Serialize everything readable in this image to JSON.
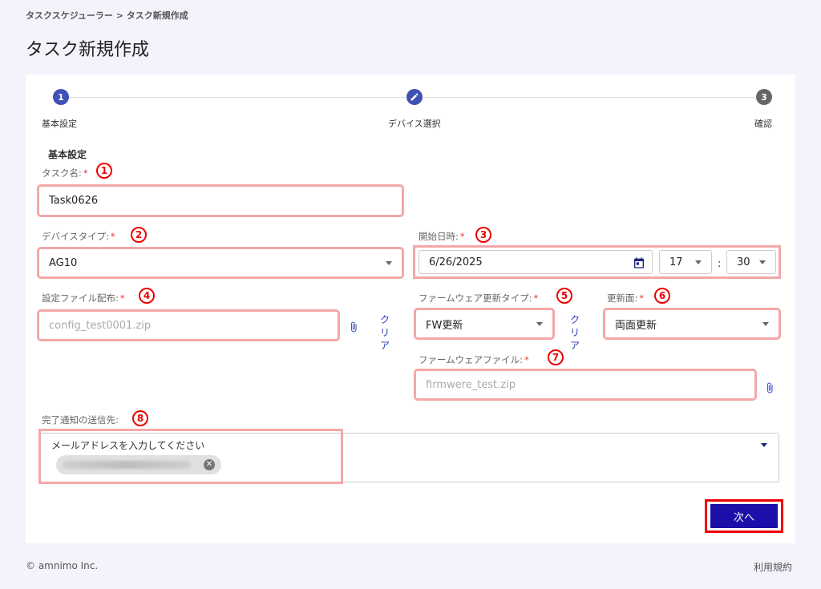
{
  "breadcrumb": "タスクスケジューラー > タスク新規作成",
  "page_title": "タスク新規作成",
  "stepper": {
    "steps": [
      {
        "num": "1",
        "label": "基本設定"
      },
      {
        "num": "",
        "label": "デバイス選択"
      },
      {
        "num": "3",
        "label": "確認"
      }
    ]
  },
  "section_title": "基本設定",
  "required_mark": "*",
  "fields": {
    "task_name": {
      "label": "タスク名:",
      "marker": "1",
      "value": "Task0626"
    },
    "device_type": {
      "label": "デバイスタイプ:",
      "marker": "2",
      "value": "AG10"
    },
    "start_datetime": {
      "label": "開始日時:",
      "marker": "3",
      "date": "6/26/2025",
      "hour": "17",
      "separator": ":",
      "minute": "30"
    },
    "config_file": {
      "label": "設定ファイル配布:",
      "marker": "4",
      "value": "config_test0001.zip",
      "clear": "クリア"
    },
    "fw_update_type": {
      "label": "ファームウェア更新タイプ:",
      "marker": "5",
      "value": "FW更新",
      "clear": "クリア"
    },
    "update_side": {
      "label": "更新面:",
      "marker": "6",
      "value": "両面更新"
    },
    "firmware_file": {
      "label": "ファームウェアファイル:",
      "marker": "7",
      "value": "firmwere_test.zip"
    },
    "notify": {
      "label": "完了通知の送信先:",
      "marker": "8",
      "placeholder": "メールアドレスを入力してください"
    }
  },
  "next_button": "次へ",
  "footer": {
    "copyright": "© amnimo Inc.",
    "terms": "利用規約"
  },
  "colors": {
    "primary": "#3f51b5",
    "button": "#1a0fa8",
    "highlight": "#f4a7a7",
    "marker": "#e00000"
  }
}
